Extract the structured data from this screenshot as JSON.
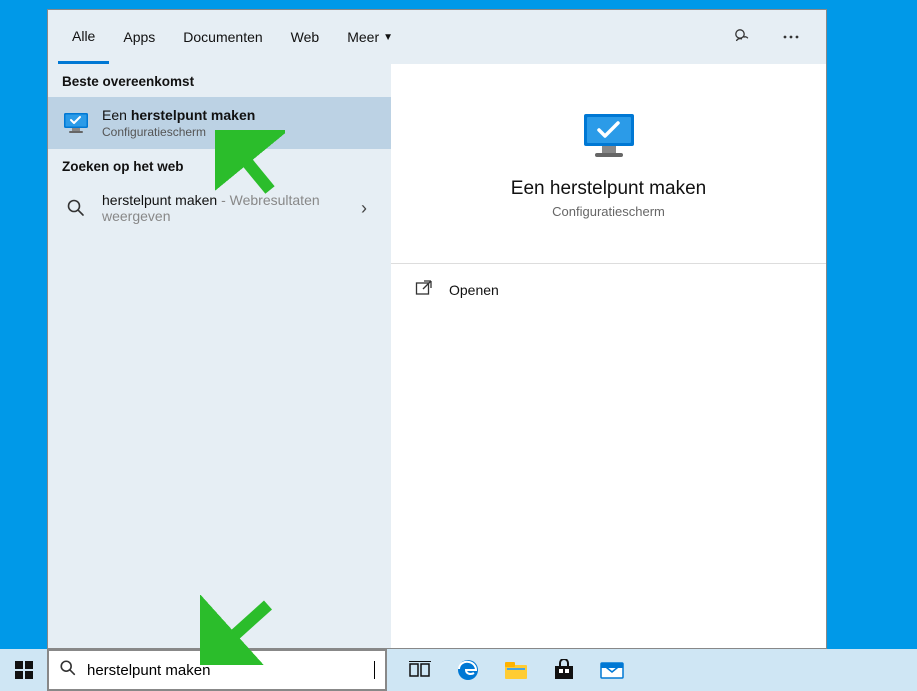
{
  "tabs": {
    "all": "Alle",
    "apps": "Apps",
    "documents": "Documenten",
    "web": "Web",
    "more": "Meer"
  },
  "sections": {
    "best_match": "Beste overeenkomst",
    "web_search": "Zoeken op het web"
  },
  "best_result": {
    "title_prefix": "Een ",
    "title_bold": "herstelpunt maken",
    "subtitle": "Configuratiescherm"
  },
  "web_result": {
    "title": "herstelpunt maken",
    "suffix": " - Webresultaten weergeven"
  },
  "preview": {
    "title": "Een herstelpunt maken",
    "subtitle": "Configuratiescherm"
  },
  "actions": {
    "open": "Openen"
  },
  "search": {
    "value": "herstelpunt maken"
  }
}
